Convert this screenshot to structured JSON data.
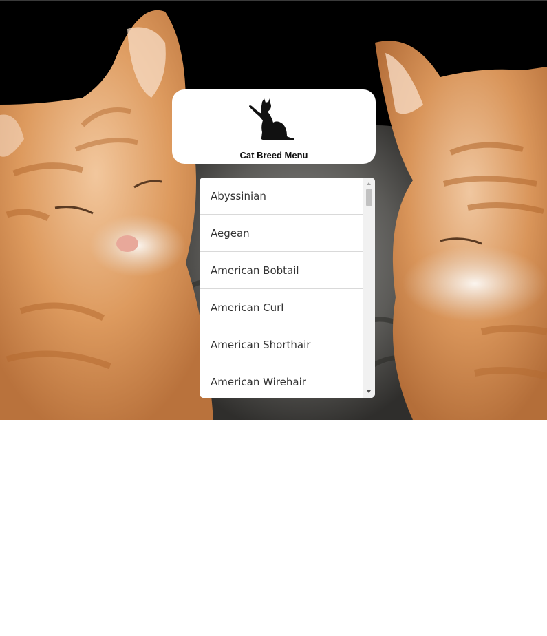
{
  "header": {
    "title": "Cat Breed Menu",
    "logo_icon": "cat-silhouette-icon"
  },
  "hero": {
    "image": "sleeping-kittens-photo"
  },
  "breeds": [
    {
      "label": "Abyssinian"
    },
    {
      "label": "Aegean"
    },
    {
      "label": "American Bobtail"
    },
    {
      "label": "American Curl"
    },
    {
      "label": "American Shorthair"
    },
    {
      "label": "American Wirehair"
    }
  ],
  "colors": {
    "hero_background": "#000000",
    "card_background": "#ffffff",
    "divider": "#d9d9d9",
    "text": "#333333"
  }
}
